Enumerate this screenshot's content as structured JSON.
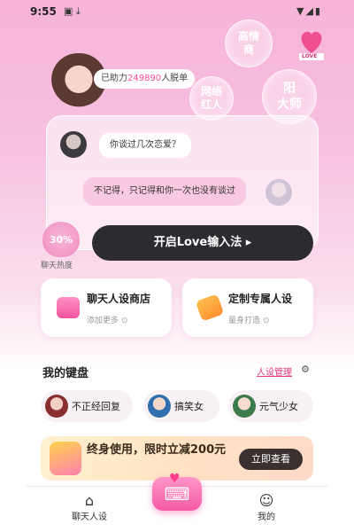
{
  "status_bar": {
    "time": "9:55",
    "left_icons": "▣ ⤓",
    "right_icons": "▼◢▮"
  },
  "bubbles": [
    {
      "label": "高情\n商"
    },
    {
      "label": "网络\n红人"
    },
    {
      "label": "阳\n大师"
    }
  ],
  "brand": {
    "logo_text": "LOVE"
  },
  "helped": {
    "prefix": "已助力",
    "count": "249890",
    "suffix": "人脱单"
  },
  "chat": {
    "question": "你谈过几次恋爱？",
    "answer": "不记得，只记得和你一次也没有谈过"
  },
  "heart_meter": {
    "value": "30%",
    "label": "聊天热度"
  },
  "open_button": {
    "label": "开启Love输入法 ▸"
  },
  "features": [
    {
      "title": "聊天人设商店",
      "subtitle": "添加更多 ⊙"
    },
    {
      "title": "定制专属人设",
      "subtitle": "量身打造 ⊙"
    }
  ],
  "keyboard": {
    "title": "我的键盘",
    "manage_label": "人设管理",
    "chips": [
      {
        "label": "不正经回复"
      },
      {
        "label": "搞笑女"
      },
      {
        "label": "元气少女"
      }
    ]
  },
  "promo": {
    "text": "终身使用，限时立减200元",
    "button": "立即查看"
  },
  "nav": {
    "left": "聊天人设",
    "right": "我的"
  },
  "colors": {
    "accent": "#ff4f9a",
    "dark_button": "#2b2b30"
  }
}
